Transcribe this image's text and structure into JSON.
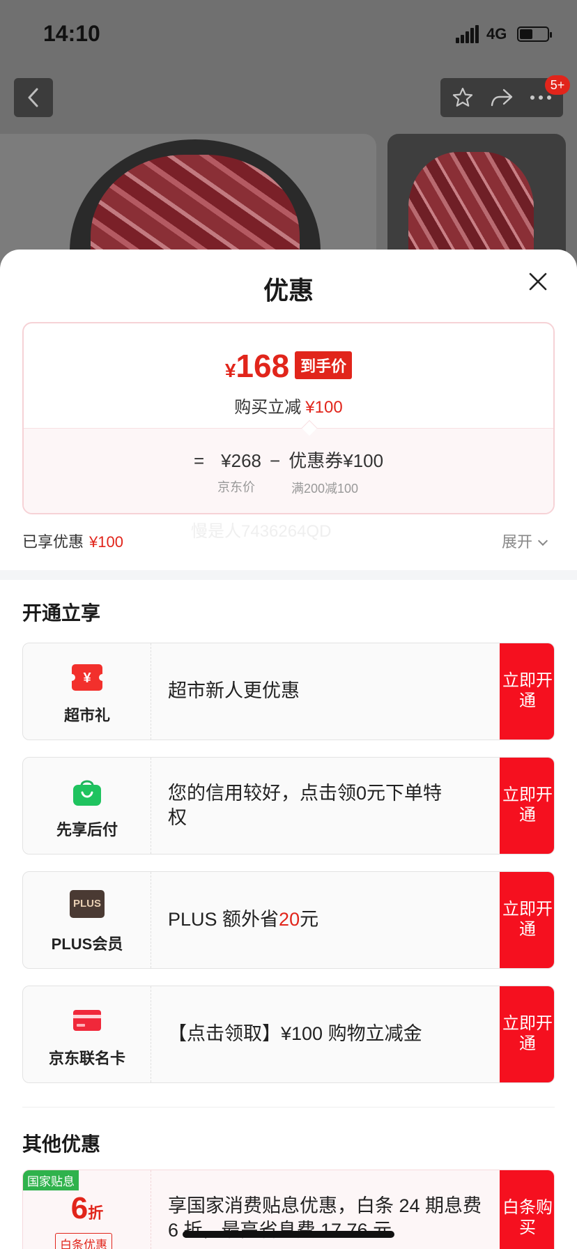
{
  "status_bar": {
    "time": "14:10",
    "network": "4G"
  },
  "nav": {
    "badge": "5+"
  },
  "sheet": {
    "title": "优惠",
    "price": {
      "currency": "¥",
      "amount": "168",
      "tag": "到手价",
      "reduce_label": "购买立减",
      "reduce_amount": "¥100"
    },
    "formula": {
      "equals": "=",
      "jd_price": "¥268",
      "minus": "−",
      "coupon": "优惠券¥100",
      "jd_price_label": "京东价",
      "coupon_rule": "满200减100"
    },
    "enjoyed_label": "已享优惠",
    "enjoyed_amount": "¥100",
    "expand_label": "展开",
    "watermark": "慢是人7436264QD"
  },
  "open_section": {
    "title": "开通立享",
    "offers": [
      {
        "name": "超市礼",
        "text": "超市新人更优惠",
        "button": "立即开通"
      },
      {
        "name": "先享后付",
        "text": "您的信用较好，点击领0元下单特权",
        "button": "立即开通"
      },
      {
        "name": "PLUS会员",
        "icon_text": "PLUS",
        "text_before": "PLUS 额外省 ",
        "text_highlight": "20",
        "text_after": " 元",
        "button": "立即开通"
      },
      {
        "name": "京东联名卡",
        "text": "【点击领取】¥100 购物立减金",
        "button": "立即开通"
      }
    ]
  },
  "other_section": {
    "title": "其他优惠",
    "offer": {
      "tag": "国家贴息",
      "discount_num": "6",
      "discount_unit": "折",
      "sub_label": "白条优惠",
      "text": "享国家消费贴息优惠，白条 24 期息费 6 折，最高省息费 17.76 元",
      "button": "白条购买"
    }
  },
  "colors": {
    "accent": "#e1251b",
    "button_red": "#f5101f",
    "subsidy_green": "#2fb24c"
  },
  "icons": [
    "back-icon",
    "star-icon",
    "share-icon",
    "more-icon",
    "close-icon",
    "red-envelope-icon",
    "shopping-bag-icon",
    "credit-card-icon"
  ]
}
